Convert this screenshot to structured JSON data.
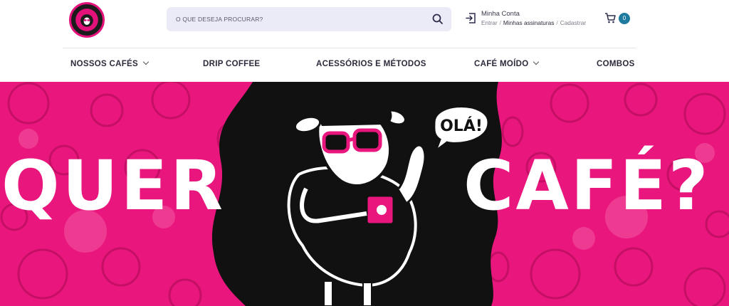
{
  "brand": {
    "logo_icon": "sheep-logo-icon",
    "accent": "#e2127a",
    "dark": "#151515"
  },
  "search": {
    "placeholder": "O QUE DESEJA PROCURAR?",
    "icon": "search-icon"
  },
  "account": {
    "title": "Minha Conta",
    "links": [
      "Entrar",
      "Minhas assinaturas",
      "Cadastrar"
    ],
    "separator": "/",
    "icon": "login-icon"
  },
  "cart": {
    "count": "0",
    "icon": "cart-icon",
    "badge_color": "#1f7aa0"
  },
  "nav": {
    "items": [
      {
        "label": "NOSSOS CAFÉS",
        "dropdown": true
      },
      {
        "label": "DRIP COFFEE",
        "dropdown": false
      },
      {
        "label": "ACESSÓRIOS E MÉTODOS",
        "dropdown": false
      },
      {
        "label": "CAFÉ MOÍDO",
        "dropdown": true
      },
      {
        "label": "COMBOS",
        "dropdown": false
      }
    ]
  },
  "hero": {
    "left_text": "QUER",
    "right_text": "CAFÉ?",
    "bubble_text": "OLÁ!",
    "mug_text": "O",
    "background_color": "#e9177d",
    "illustration": "sheep-with-sunglasses-mascot"
  }
}
